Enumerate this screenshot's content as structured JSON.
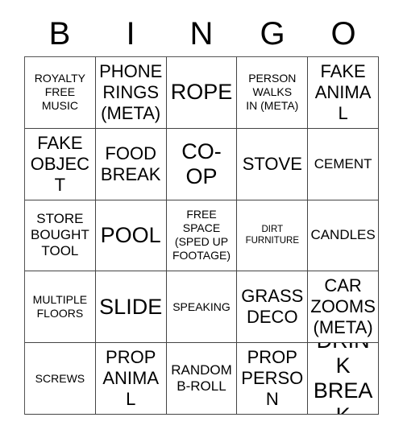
{
  "card": {
    "title": "BINGO",
    "header_letters": [
      "B",
      "I",
      "N",
      "G",
      "O"
    ],
    "columns": 5,
    "rows": 5,
    "free_space_index": 12,
    "colors": {
      "background": "#ffffff",
      "text": "#000000",
      "grid_line": "#444444"
    },
    "cells": [
      {
        "text": "ROYALTY\nFREE\nMUSIC",
        "size": "sm"
      },
      {
        "text": "PHONE\nRINGS\n(META)",
        "size": "lg"
      },
      {
        "text": "ROPE",
        "size": "xl"
      },
      {
        "text": "PERSON\nWALKS\nIN (META)",
        "size": "sm"
      },
      {
        "text": "FAKE\nANIMAL",
        "size": "lg"
      },
      {
        "text": "FAKE\nOBJECT",
        "size": "lg"
      },
      {
        "text": "FOOD\nBREAK",
        "size": "lg"
      },
      {
        "text": "CO-\nOP",
        "size": "xl"
      },
      {
        "text": "STOVE",
        "size": "lg"
      },
      {
        "text": "CEMENT",
        "size": "md"
      },
      {
        "text": "STORE\nBOUGHT\nTOOL",
        "size": "md"
      },
      {
        "text": "POOL",
        "size": "xl"
      },
      {
        "text": "FREE\nSPACE\n(SPED UP\nFOOTAGE)",
        "size": "sm"
      },
      {
        "text": "DIRT\nFURNITURE",
        "size": "xs"
      },
      {
        "text": "CANDLES",
        "size": "md"
      },
      {
        "text": "MULTIPLE\nFLOORS",
        "size": "sm"
      },
      {
        "text": "SLIDE",
        "size": "xl"
      },
      {
        "text": "SPEAKING",
        "size": "sm"
      },
      {
        "text": "GRASS\nDECO",
        "size": "lg"
      },
      {
        "text": "CAR\nZOOMS\n(META)",
        "size": "lg"
      },
      {
        "text": "SCREWS",
        "size": "sm"
      },
      {
        "text": "PROP\nANIMAL",
        "size": "lg"
      },
      {
        "text": "RANDOM\nB-ROLL",
        "size": "md"
      },
      {
        "text": "PROP\nPERSON",
        "size": "lg"
      },
      {
        "text": "DRINK\nBREAK",
        "size": "xl"
      }
    ]
  }
}
